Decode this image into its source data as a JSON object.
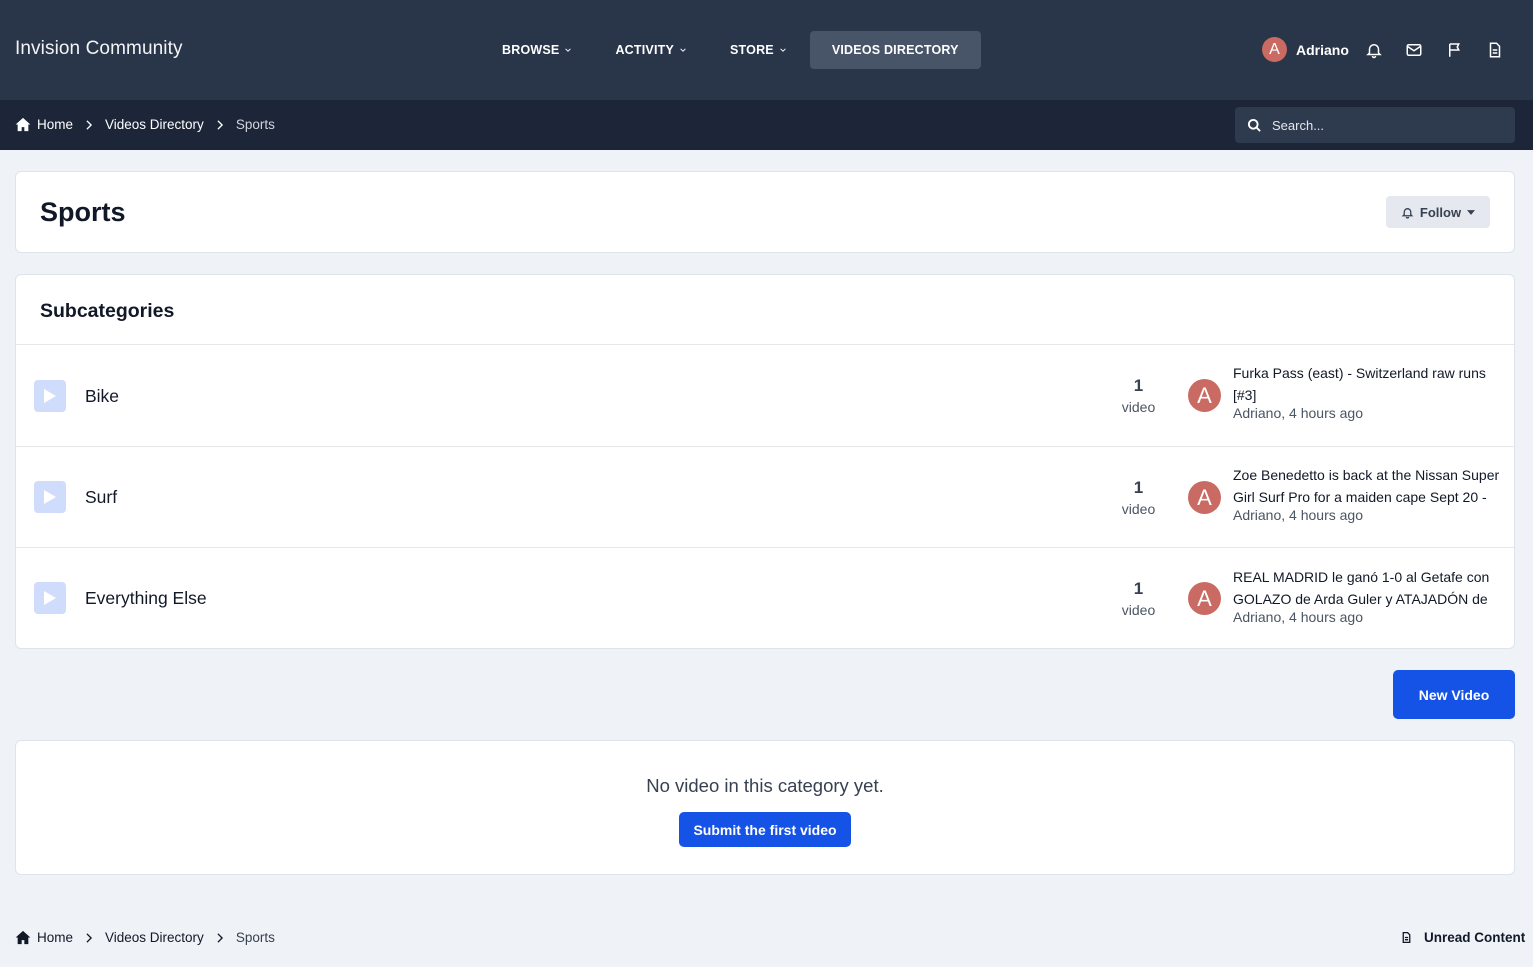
{
  "header": {
    "brand": "Invision Community",
    "nav": [
      {
        "label": "BROWSE",
        "dropdown": true
      },
      {
        "label": "ACTIVITY",
        "dropdown": true
      },
      {
        "label": "STORE",
        "dropdown": true
      },
      {
        "label": "VIDEOS DIRECTORY",
        "dropdown": false,
        "active": true
      }
    ],
    "user": {
      "initial": "A",
      "name": "Adriano"
    },
    "icons": [
      "bell-icon",
      "envelope-icon",
      "flag-icon",
      "document-icon"
    ]
  },
  "breadcrumb": {
    "items": [
      "Home",
      "Videos Directory",
      "Sports"
    ]
  },
  "search": {
    "placeholder": "Search..."
  },
  "page": {
    "title": "Sports",
    "follow_label": "Follow"
  },
  "subcategories": {
    "title": "Subcategories",
    "rows": [
      {
        "name": "Bike",
        "count": "1",
        "unit": "video",
        "avatar": "A",
        "last_title": "Furka Pass (east) - Switzerland raw runs [#3]",
        "last_meta": "Adriano, 4 hours ago"
      },
      {
        "name": "Surf",
        "count": "1",
        "unit": "video",
        "avatar": "A",
        "last_title": "Zoe Benedetto is back at the Nissan Super Girl Surf Pro for a maiden cape Sept 20 -",
        "last_meta": "Adriano, 4 hours ago"
      },
      {
        "name": "Everything Else",
        "count": "1",
        "unit": "video",
        "avatar": "A",
        "last_title": "REAL MADRID le ganó 1-0 al Getafe con GOLAZO de Arda Guler y ATAJADÓN de",
        "last_meta": "Adriano, 4 hours ago"
      }
    ]
  },
  "actions": {
    "new_video": "New Video"
  },
  "empty": {
    "message": "No video in this category yet.",
    "submit_label": "Submit the first video"
  },
  "footer": {
    "breadcrumb": [
      "Home",
      "Videos Directory",
      "Sports"
    ],
    "unread_label": "Unread Content"
  },
  "colors": {
    "header_bg": "#293548",
    "crumb_bg": "#1c2638",
    "accent": "#1552e6",
    "avatar": "#c96b63",
    "page_bg": "#eff2f7"
  }
}
